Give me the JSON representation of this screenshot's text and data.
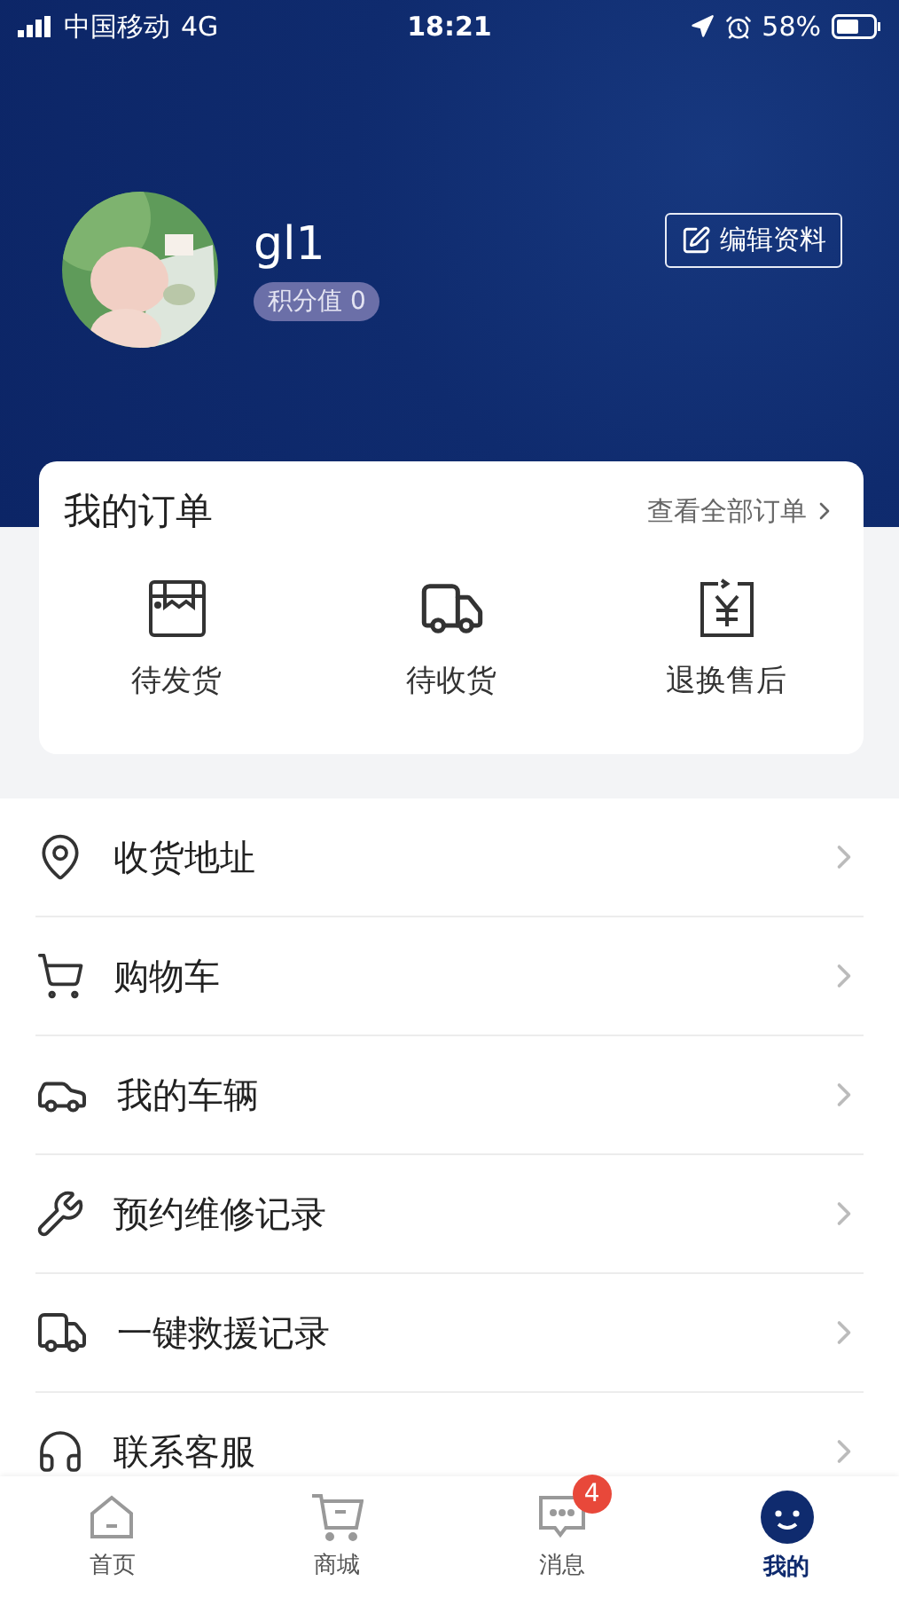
{
  "status_bar": {
    "carrier": "中国移动",
    "network": "4G",
    "time": "18:21",
    "battery": "58%"
  },
  "profile": {
    "name": "gl1",
    "points": "积分值 0",
    "edit_button": "编辑资料"
  },
  "orders": {
    "title": "我的订单",
    "view_all": "查看全部订单",
    "items": [
      {
        "kind": "box",
        "label": "待发货"
      },
      {
        "kind": "truck",
        "label": "待收货"
      },
      {
        "kind": "refund",
        "label": "退换售后"
      }
    ]
  },
  "menu": [
    {
      "kind": "address",
      "label": "收货地址"
    },
    {
      "kind": "cart",
      "label": "购物车"
    },
    {
      "kind": "car",
      "label": "我的车辆"
    },
    {
      "kind": "repair",
      "label": "预约维修记录"
    },
    {
      "kind": "rescue",
      "label": "一键救援记录"
    },
    {
      "kind": "service",
      "label": "联系客服"
    }
  ],
  "tabs": [
    {
      "kind": "home",
      "label": "首页",
      "selected": false
    },
    {
      "kind": "shop",
      "label": "商城",
      "selected": false
    },
    {
      "kind": "messages",
      "label": "消息",
      "selected": false,
      "badge": "4"
    },
    {
      "kind": "me",
      "label": "我的",
      "selected": true
    }
  ]
}
